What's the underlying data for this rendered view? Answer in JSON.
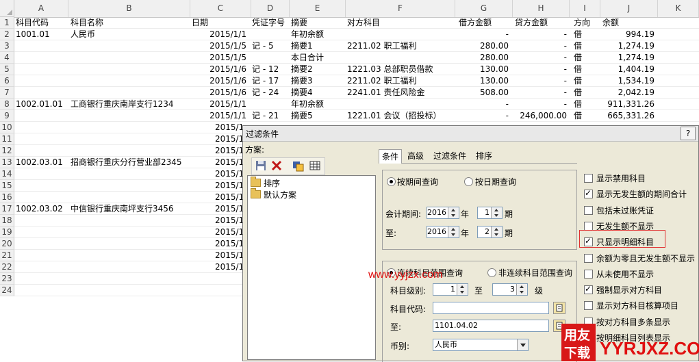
{
  "columns": [
    "A",
    "B",
    "C",
    "D",
    "E",
    "F",
    "G",
    "H",
    "I",
    "J",
    "K"
  ],
  "row_numbers": [
    "1",
    "2",
    "3",
    "4",
    "5",
    "6",
    "7",
    "8",
    "9",
    "10",
    "11",
    "12",
    "13",
    "14",
    "15",
    "16",
    "17",
    "18",
    "19",
    "20",
    "21",
    "22",
    "23",
    "24"
  ],
  "header_row": {
    "a": "科目代码",
    "b": "科目名称",
    "b2": "日期",
    "d": "凭证字号",
    "e": "摘要",
    "f": "对方科目",
    "g": "借方金额",
    "h": "贷方金额",
    "i": "方向",
    "j": "余额"
  },
  "rows": [
    {
      "a": "1001.01",
      "b": "人民币",
      "c": "2015/1/1",
      "d": "",
      "e": "年初余额",
      "f": "",
      "g": "-",
      "h": "-",
      "i": "借",
      "j": "994.19"
    },
    {
      "a": "",
      "b": "",
      "c": "2015/1/5",
      "d": "记 - 5",
      "e": "摘要1",
      "f": "2211.02 职工福利",
      "g": "280.00",
      "h": "-",
      "i": "借",
      "j": "1,274.19"
    },
    {
      "a": "",
      "b": "",
      "c": "2015/1/5",
      "d": "",
      "e": "本日合计",
      "f": "",
      "g": "280.00",
      "h": "-",
      "i": "借",
      "j": "1,274.19"
    },
    {
      "a": "",
      "b": "",
      "c": "2015/1/6",
      "d": "记 - 12",
      "e": "摘要2",
      "f": "1221.03 总部职员借款",
      "g": "130.00",
      "h": "-",
      "i": "借",
      "j": "1,404.19"
    },
    {
      "a": "",
      "b": "",
      "c": "2015/1/6",
      "d": "记 - 17",
      "e": "摘要3",
      "f": "2211.02 职工福利",
      "g": "130.00",
      "h": "-",
      "i": "借",
      "j": "1,534.19"
    },
    {
      "a": "",
      "b": "",
      "c": "2015/1/6",
      "d": "记 - 24",
      "e": "摘要4",
      "f": "2241.01 责任风险金",
      "g": "508.00",
      "h": "-",
      "i": "借",
      "j": "2,042.19"
    },
    {
      "a": "1002.01.01",
      "b": "工商银行重庆南岸支行1234",
      "c": "2015/1/1",
      "d": "",
      "e": "年初余额",
      "f": "",
      "g": "-",
      "h": "-",
      "i": "借",
      "j": "911,331.26"
    },
    {
      "a": "",
      "b": "",
      "c": "2015/1/1",
      "d": "记 - 21",
      "e": "摘要5",
      "f": "1221.01 会议（招投标）",
      "g": "-",
      "h": "246,000.00",
      "i": "借",
      "j": "665,331.26"
    },
    {
      "a": "",
      "b": "",
      "c": "2015/1,",
      "d": "",
      "e": "",
      "f": "",
      "g": "",
      "h": "",
      "i": "",
      "j": ""
    },
    {
      "a": "",
      "b": "",
      "c": "2015/1,",
      "d": "",
      "e": "",
      "f": "",
      "g": "",
      "h": "",
      "i": "",
      "j": ""
    },
    {
      "a": "",
      "b": "",
      "c": "2015/1,",
      "d": "",
      "e": "",
      "f": "",
      "g": "",
      "h": "",
      "i": "",
      "j": ""
    },
    {
      "a": "1002.03.01",
      "b": "招商银行重庆分行营业部2345",
      "c": "2015/1,",
      "d": "",
      "e": "",
      "f": "",
      "g": "",
      "h": "",
      "i": "",
      "j": ""
    },
    {
      "a": "",
      "b": "",
      "c": "2015/1,",
      "d": "",
      "e": "",
      "f": "",
      "g": "",
      "h": "",
      "i": "",
      "j": ""
    },
    {
      "a": "",
      "b": "",
      "c": "2015/1,",
      "d": "",
      "e": "",
      "f": "",
      "g": "",
      "h": "",
      "i": "",
      "j": ""
    },
    {
      "a": "",
      "b": "",
      "c": "2015/1,",
      "d": "",
      "e": "",
      "f": "",
      "g": "",
      "h": "",
      "i": "",
      "j": ""
    },
    {
      "a": "1002.03.02",
      "b": "中信银行重庆南坪支行3456",
      "c": "2015/1,",
      "d": "",
      "e": "",
      "f": "",
      "g": "",
      "h": "",
      "i": "",
      "j": ""
    },
    {
      "a": "",
      "b": "",
      "c": "2015/1,",
      "d": "",
      "e": "",
      "f": "",
      "g": "",
      "h": "",
      "i": "",
      "j": ""
    },
    {
      "a": "",
      "b": "",
      "c": "2015/1,",
      "d": "",
      "e": "",
      "f": "",
      "g": "",
      "h": "",
      "i": "",
      "j": ""
    },
    {
      "a": "",
      "b": "",
      "c": "2015/1,",
      "d": "",
      "e": "",
      "f": "",
      "g": "",
      "h": "",
      "i": "",
      "j": ""
    },
    {
      "a": "",
      "b": "",
      "c": "2015/1,",
      "d": "",
      "e": "",
      "f": "",
      "g": "",
      "h": "",
      "i": "",
      "j": ""
    },
    {
      "a": "",
      "b": "",
      "c": "2015/1,",
      "d": "",
      "e": "",
      "f": "",
      "g": "",
      "h": "",
      "i": "",
      "j": ""
    },
    {
      "a": "",
      "b": "",
      "c": "",
      "d": "",
      "e": "",
      "f": "",
      "g": "",
      "h": "",
      "i": "",
      "j": ""
    },
    {
      "a": "",
      "b": "",
      "c": "",
      "d": "",
      "e": "",
      "f": "",
      "g": "",
      "h": "",
      "i": "",
      "j": ""
    }
  ],
  "dialog": {
    "title": "过滤条件",
    "help": "?",
    "scheme_label": "方案:",
    "tree_items": [
      "排序",
      "默认方案"
    ],
    "tabs": [
      "条件",
      "高级",
      "过滤条件",
      "排序"
    ],
    "radio_period": "按期间查询",
    "radio_date": "按日期查询",
    "period_label": "会计期间:",
    "to_label": "至:",
    "year_from": "2016",
    "year_unit": "年",
    "period_from": "1",
    "period_unit": "期",
    "year_to": "2016",
    "period_to": "2",
    "radio_continuous": "连续科目范围查询",
    "radio_noncontinuous": "非连续科目范围查询",
    "level_label": "科目级别:",
    "level_from": "1",
    "level_to_label": "至",
    "level_to": "3",
    "level_unit": "级",
    "code_label": "科目代码:",
    "code_value": "",
    "code_to_label": "至:",
    "code_to_value": "1101.04.02",
    "currency_label": "币别:",
    "currency_value": "人民币",
    "checkboxes": [
      {
        "label": "显示禁用科目",
        "checked": false
      },
      {
        "label": "显示无发生额的期间合计",
        "checked": true
      },
      {
        "label": "包括未过账凭证",
        "checked": false
      },
      {
        "label": "无发生额不显示",
        "checked": false
      },
      {
        "label": "只显示明细科目",
        "checked": true
      },
      {
        "label": "余额为零且无发生额不显示",
        "checked": false
      },
      {
        "label": "从未使用不显示",
        "checked": false
      },
      {
        "label": "强制显示对方科目",
        "checked": true
      },
      {
        "label": "显示对方科目核算项目",
        "checked": false
      },
      {
        "label": "按对方科目多条显示",
        "checked": false
      },
      {
        "label": "按明细科目列表显示",
        "checked": false
      }
    ]
  },
  "watermark": {
    "url": "www.yyjzx.com",
    "logo_top": "用友",
    "logo_bottom": "下载",
    "brand": "YYRJXZ.COM"
  },
  "colors": {
    "highlight_border": "#e03030",
    "watermark_red": "#e01010"
  }
}
